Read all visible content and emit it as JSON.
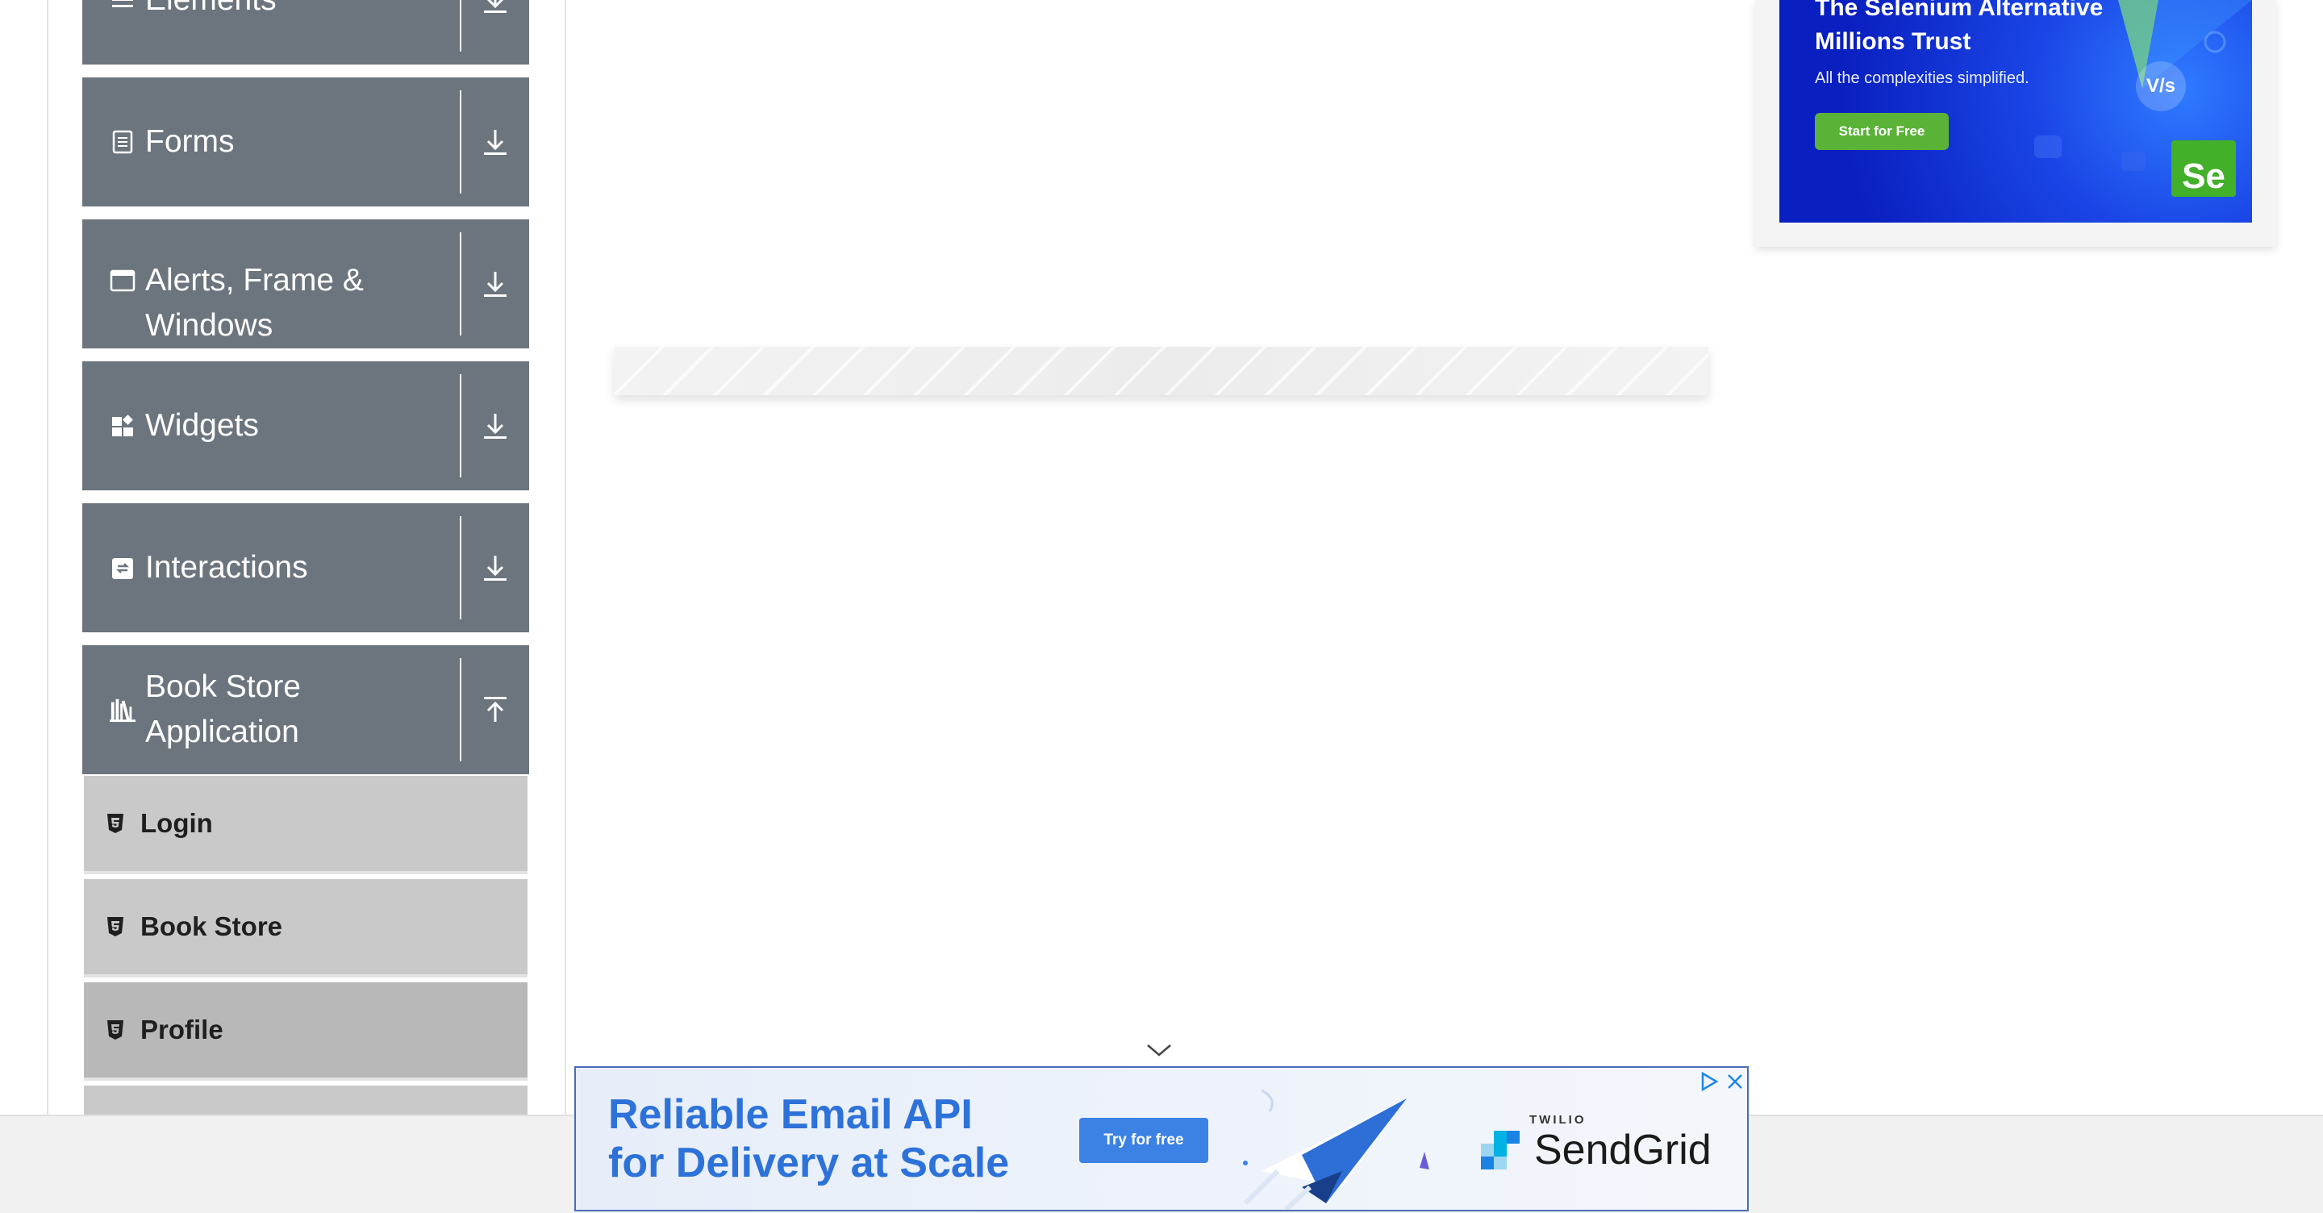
{
  "sidebar": {
    "groups": [
      {
        "title": "Elements",
        "icon": "menu-lines-icon",
        "state": "collapsed"
      },
      {
        "title": "Forms",
        "icon": "form-document-icon",
        "state": "collapsed"
      },
      {
        "title": "Alerts, Frame & Windows",
        "title_line1": "Alerts, Frame &",
        "title_line2": "Windows",
        "icon": "window-icon",
        "state": "collapsed"
      },
      {
        "title": "Widgets",
        "icon": "widgets-icon",
        "state": "collapsed"
      },
      {
        "title": "Interactions",
        "icon": "interactions-icon",
        "state": "collapsed"
      },
      {
        "title": "Book Store Application",
        "icon": "bookshelf-icon",
        "state": "expanded"
      }
    ],
    "book_store_items": [
      {
        "label": "Login",
        "icon": "html5-badge-icon"
      },
      {
        "label": "Book Store",
        "icon": "html5-badge-icon"
      },
      {
        "label": "Profile",
        "icon": "html5-badge-icon",
        "active": true
      }
    ]
  },
  "ad_top": {
    "headline_line1": "The Selenium Alternative",
    "headline_line2": "Millions Trust",
    "subtitle": "All the complexities simplified.",
    "cta": "Start for Free",
    "badge": "V/s",
    "logo": "Se"
  },
  "ad_bottom": {
    "headline_line1": "Reliable Email API",
    "headline_line2": "for Delivery at Scale",
    "cta": "Try for free",
    "brand_top": "TWILIO",
    "brand": "SendGrid"
  },
  "colors": {
    "group_bg": "#6c757d",
    "sub_bg": "#c9c9c9",
    "sub_active_bg": "#b8b8b8",
    "selenium_blue": "#1a45e6",
    "selenium_green": "#43b02a",
    "sendgrid_blue": "#2d72d9"
  }
}
